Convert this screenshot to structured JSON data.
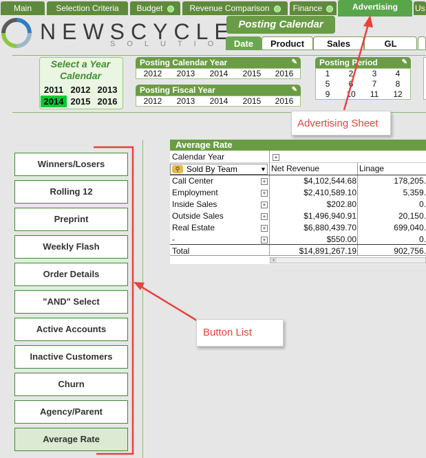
{
  "top_tabs": [
    {
      "label": "Main",
      "dot": false
    },
    {
      "label": "Selection Criteria",
      "dot": false
    },
    {
      "label": "Budget",
      "dot": true
    },
    {
      "label": "Revenue Comparison",
      "dot": true
    },
    {
      "label": "Finance",
      "dot": true
    },
    {
      "label": "Advertising",
      "dot": false
    },
    {
      "label": "Us",
      "dot": false
    }
  ],
  "logo": {
    "name": "NEWSCYCLE",
    "sub": "SOLUTIONS"
  },
  "sheet_title": "Posting Calendar",
  "sub_tabs": [
    "Date",
    "Product",
    "Sales",
    "GL"
  ],
  "year_select": {
    "title": "Select a Year Calendar",
    "years": [
      "2011",
      "2012",
      "2013",
      "2014",
      "2015",
      "2016"
    ],
    "selected": "2014"
  },
  "posting_calendar_year": {
    "title": "Posting Calendar Year",
    "values": [
      "2012",
      "2013",
      "2014",
      "2015",
      "2016"
    ]
  },
  "posting_fiscal_year": {
    "title": "Posting Fiscal Year",
    "values": [
      "2012",
      "2013",
      "2014",
      "2015",
      "2016"
    ]
  },
  "posting_period": {
    "title": "Posting Period",
    "values": [
      "1",
      "2",
      "3",
      "4",
      "5",
      "6",
      "7",
      "8",
      "9",
      "10",
      "11",
      "12"
    ]
  },
  "annotations": {
    "advertising_sheet": "Advertising Sheet",
    "button_list": "Button List"
  },
  "buttons": [
    "Winners/Losers",
    "Rolling 12",
    "Preprint",
    "Weekly Flash",
    "Order Details",
    "\"AND\" Select",
    "Active Accounts",
    "Inactive Customers",
    "Churn",
    "Agency/Parent",
    "Average Rate"
  ],
  "table": {
    "title": "Average Rate",
    "dim_header": "Calendar Year",
    "row_dim": "Sold By Team",
    "col_headers": [
      "Net Revenue",
      "Linage"
    ],
    "rows": [
      {
        "team": "Call Center",
        "net": "$4,102,544.68",
        "linage": "178,205."
      },
      {
        "team": "Employment",
        "net": "$2,410,589.10",
        "linage": "5,359."
      },
      {
        "team": "Inside Sales",
        "net": "$202.80",
        "linage": "0."
      },
      {
        "team": "Outside Sales",
        "net": "$1,496,940.91",
        "linage": "20,150."
      },
      {
        "team": "Real Estate",
        "net": "$6,880,439.70",
        "linage": "699,040."
      },
      {
        "team": "-",
        "net": "$550.00",
        "linage": "0."
      }
    ],
    "total": {
      "label": "Total",
      "net": "$14,891,267.19",
      "linage": "902,756."
    }
  },
  "colors": {
    "accent": "#6a9c45",
    "annotation": "#e8423c",
    "selected_year": "#00cc33"
  }
}
